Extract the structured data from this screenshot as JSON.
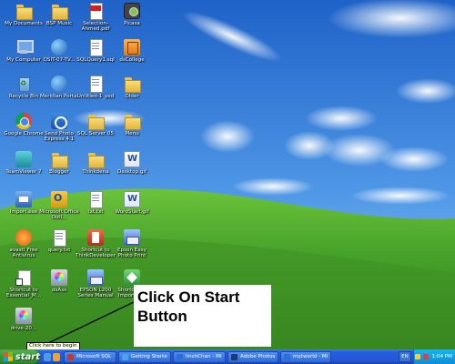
{
  "desktop": {
    "icons": [
      {
        "label": "My Documents",
        "icon": "folder-icon"
      },
      {
        "label": "BSP Music",
        "icon": "folder-icon"
      },
      {
        "label": "Selection-Ahmed.pdf",
        "icon": "pdf-icon"
      },
      {
        "label": "Picasa",
        "icon": "camera-icon"
      },
      {
        "label": "My Computer",
        "icon": "computer-icon"
      },
      {
        "label": "QSIT-07-TV...",
        "icon": "globe-icon"
      },
      {
        "label": "SQLQuery1.sql",
        "icon": "document-icon"
      },
      {
        "label": "dsCollege",
        "icon": "orange-app-icon"
      },
      {
        "label": "Recycle Bin",
        "icon": "recycle-bin-icon"
      },
      {
        "label": "Meridian Portal",
        "icon": "globe-icon"
      },
      {
        "label": "Untitled-1_psd",
        "icon": "document-icon"
      },
      {
        "label": "Older",
        "icon": "folder-icon"
      },
      {
        "label": "Google Chrome",
        "icon": "chrome-icon"
      },
      {
        "label": "Send Photo Express 4.1",
        "icon": "blue-app-icon"
      },
      {
        "label": "SQL Server 05",
        "icon": "folder-icon"
      },
      {
        "label": "Menu",
        "icon": "folder-icon"
      },
      {
        "label": "TeamViewer 7",
        "icon": "teal-app-icon"
      },
      {
        "label": "Blogger",
        "icon": "folder-icon"
      },
      {
        "label": "Thinkdena",
        "icon": "folder-icon"
      },
      {
        "label": "Desktop.gif",
        "icon": "word-icon"
      },
      {
        "label": "Import.exe",
        "icon": "import-icon"
      },
      {
        "label": "Microsoft Office Outl...",
        "icon": "outlook-icon"
      },
      {
        "label": "txt.txt",
        "icon": "document-icon"
      },
      {
        "label": "WordStart.gif",
        "icon": "word-icon"
      },
      {
        "label": "avast! Free Antivirus",
        "icon": "avast-icon"
      },
      {
        "label": "query.txt",
        "icon": "document-icon"
      },
      {
        "label": "Shortcut to ThinkDeveloper",
        "icon": "red-app-icon"
      },
      {
        "label": "Epson Easy Photo Print",
        "icon": "epson-icon"
      },
      {
        "label": "Shortcut to Essential_M...",
        "icon": "shortcut-icon"
      },
      {
        "label": "dsAss",
        "icon": "dvd-icon"
      },
      {
        "label": "EPSON L200 Series Manual",
        "icon": "epson-icon"
      },
      {
        "label": "Shortcut to Import.exe",
        "icon": "green-app-icon"
      },
      {
        "label": "drive-20...",
        "icon": "dvd-icon"
      }
    ]
  },
  "callout": {
    "text": "Click On Start Button"
  },
  "tooltip": {
    "text": "Click here to begin"
  },
  "taskbar": {
    "start_label": "start",
    "tasks": [
      {
        "label": "Microsoft SQL Se...",
        "color": "#c23b2c"
      },
      {
        "label": "Getting Started - ...",
        "color": "#4aa3e8"
      },
      {
        "label": "linshChen - Micr...",
        "color": "#2d6fd6"
      },
      {
        "label": "Adobe Photoshop",
        "color": "#1f3a70"
      },
      {
        "label": "mytworld - Micro...",
        "color": "#2d6fd6"
      }
    ],
    "language": "EN",
    "clock": "1:04 PM"
  },
  "colors": {
    "sky_top": "#2a6fd0",
    "sky_bottom": "#8cc2f2",
    "hill": "#3f9a2a",
    "taskbar": "#245edb",
    "start_button": "#3c9a3c"
  }
}
